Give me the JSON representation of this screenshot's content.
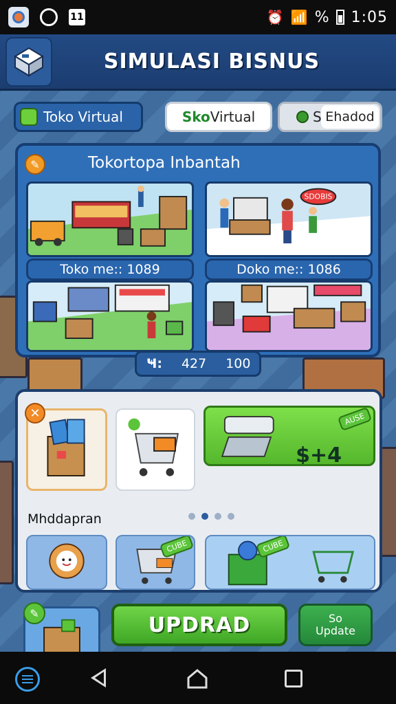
{
  "status_bar": {
    "time": "1:05",
    "battery_percent_symbol": "%",
    "icons": [
      "app-icon",
      "circle-app-icon",
      "calendar-icon",
      "alarm-icon",
      "wifi-icon",
      "signal-icon",
      "battery-icon"
    ]
  },
  "header": {
    "title": "SIMULASI BISNUS",
    "logo_icon": "store-logo-icon"
  },
  "tabs": [
    {
      "label": "Toko Virtual",
      "icon": "box-icon"
    },
    {
      "label_accent": "Sko",
      "label_rest": " Virtual"
    },
    {
      "label_prefix": "S",
      "label_sub": "Ehadod",
      "icon": "coin-icon"
    }
  ],
  "store_panel": {
    "title": "Tokortopa Inbantah",
    "edit_icon": "pencil-icon",
    "scenes": [
      {
        "label": "Toko me:: 1089"
      },
      {
        "label": "Doko me:: 1086",
        "speech": "SDOBIS"
      },
      {
        "label": ""
      },
      {
        "label": ""
      }
    ],
    "stats": {
      "icon": "Ҹ:",
      "value_1": "427",
      "value_2": "100"
    }
  },
  "upgrades_panel": {
    "close_icon": "close-icon",
    "price_label": "$+4",
    "tag_text": "AUSE",
    "section_label": "Mhddapran",
    "pager": {
      "pages": 4,
      "active": 1
    },
    "cards_row2": [
      {
        "icon": "mascot-icon"
      },
      {
        "icon": "cart-icon",
        "tag": "CUBE"
      },
      {
        "icon": "globe-register-icon",
        "tag": "CUBE"
      }
    ]
  },
  "bottom_row": {
    "side_card_icon": "pencil-icon",
    "upgrade_label": "UPDRAD",
    "small_button_line1": "So",
    "small_button_line2": "Update"
  },
  "colors": {
    "header_bg": "#1b3d70",
    "panel_blue": "#2f6fb8",
    "upgrade_green": "#4fb82e",
    "accent_orange": "#f29a26"
  }
}
